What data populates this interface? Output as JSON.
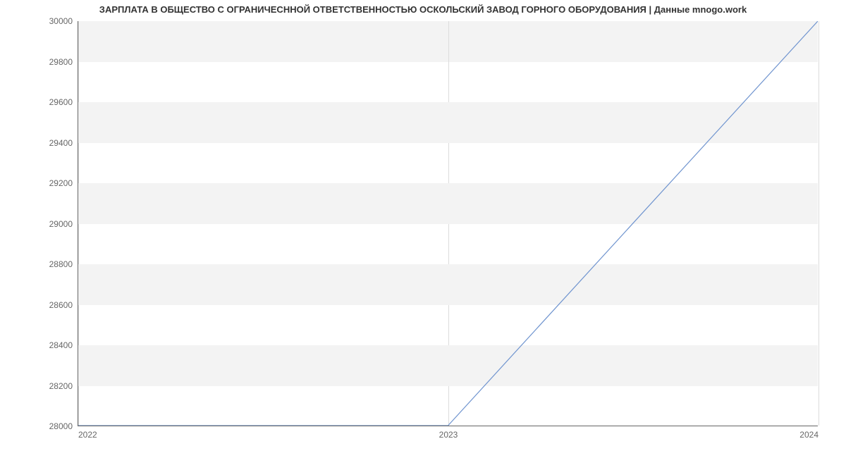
{
  "chart_data": {
    "type": "line",
    "title": "ЗАРПЛАТА В ОБЩЕСТВО С ОГРАНИЧЕСННОЙ ОТВЕТСТВЕННОСТЬЮ ОСКОЛЬСКИЙ ЗАВОД ГОРНОГО ОБОРУДОВАНИЯ | Данные mnogo.work",
    "xlabel": "",
    "ylabel": "",
    "x_ticks": [
      "2022",
      "2023",
      "2024"
    ],
    "y_ticks": [
      28000,
      28200,
      28400,
      28600,
      28800,
      29000,
      29200,
      29400,
      29600,
      29800,
      30000
    ],
    "ylim": [
      28000,
      30000
    ],
    "x": [
      2022,
      2023,
      2024
    ],
    "values": [
      28000,
      28000,
      30000
    ],
    "line_color": "#6f94cf"
  }
}
